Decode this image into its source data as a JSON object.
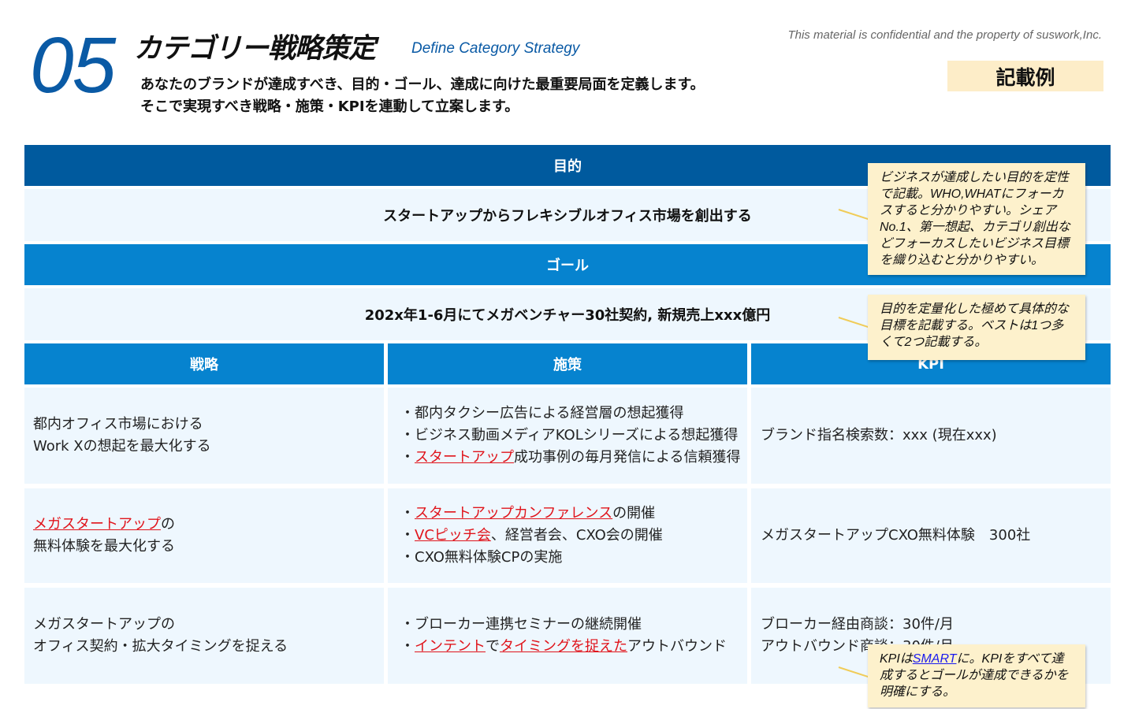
{
  "header": {
    "number": "05",
    "title": "カテゴリー戦略策定",
    "subtitle_en": "Define Category Strategy",
    "description_line1": "あなたのブランドが達成すべき、目的・ゴール、達成に向けた最重要局面を定義します。",
    "description_line2": "そこで実現すべき戦略・施策・KPIを連動して立案します。",
    "confidential": "This material is confidential and the property of suswork,Inc.",
    "example_badge": "記載例"
  },
  "purpose": {
    "label": "目的",
    "value": "スタートアップからフレキシブルオフィス市場を創出する"
  },
  "goal": {
    "label": "ゴール",
    "value": "202x年1-6月にてメガベンチャー30社契約, 新規売上xxx億円"
  },
  "columns": {
    "strategy": "戦略",
    "measures": "施策",
    "kpi": "KPI"
  },
  "rows": [
    {
      "strategy": [
        "都内オフィス市場における",
        "Work Xの想起を最大化する"
      ],
      "measures": [
        [
          "・都内タクシー広告による経営層の想起獲得"
        ],
        [
          "・ビジネス動画メディアKOLシリーズによる想起獲得"
        ],
        [
          "・",
          "スタートアップ",
          "成功事例の毎月発信による信頼獲得"
        ]
      ],
      "kpi": [
        "ブランド指名検索数：xxx (現在xxx)"
      ]
    },
    {
      "strategy": [
        "メガスタートアップ",
        "の",
        "無料体験を最大化する"
      ],
      "measures": [
        [
          "・",
          "スタートアップカンファレンス",
          "の開催"
        ],
        [
          "・",
          "VCピッチ会",
          "、経営者会、CXO会の開催"
        ],
        [
          "・CXO無料体験CPの実施"
        ]
      ],
      "kpi": [
        "メガスタートアップCXO無料体験　300社"
      ]
    },
    {
      "strategy": [
        "メガスタートアップの",
        "オフィス契約・拡大タイミングを捉える"
      ],
      "measures": [
        [
          "・ブローカー連携セミナーの継続開催"
        ],
        [
          "・",
          "インテント",
          "で",
          "タイミングを捉えた",
          "アウトバウンド"
        ]
      ],
      "kpi": [
        "ブローカー経由商談：30件/月",
        "アウトバウンド商談：30件/月"
      ]
    }
  ],
  "notes": {
    "purpose_note": "ビジネスが達成したい目的を定性で記載。WHO,WHATにフォーカスすると分かりやすい。シェアNo.1、第一想起、カテゴリ創出などフォーカスしたいビジネス目標を織り込むと分かりやすい。",
    "goal_note": "目的を定量化した極めて具体的な目標を記載する。ベストは1つ多くて2つ記載する。",
    "kpi_note_pre": "KPIは",
    "kpi_note_link": "SMART",
    "kpi_note_post": "に。KPIをすべて達成するとゴールが達成できるかを明確にする。"
  }
}
